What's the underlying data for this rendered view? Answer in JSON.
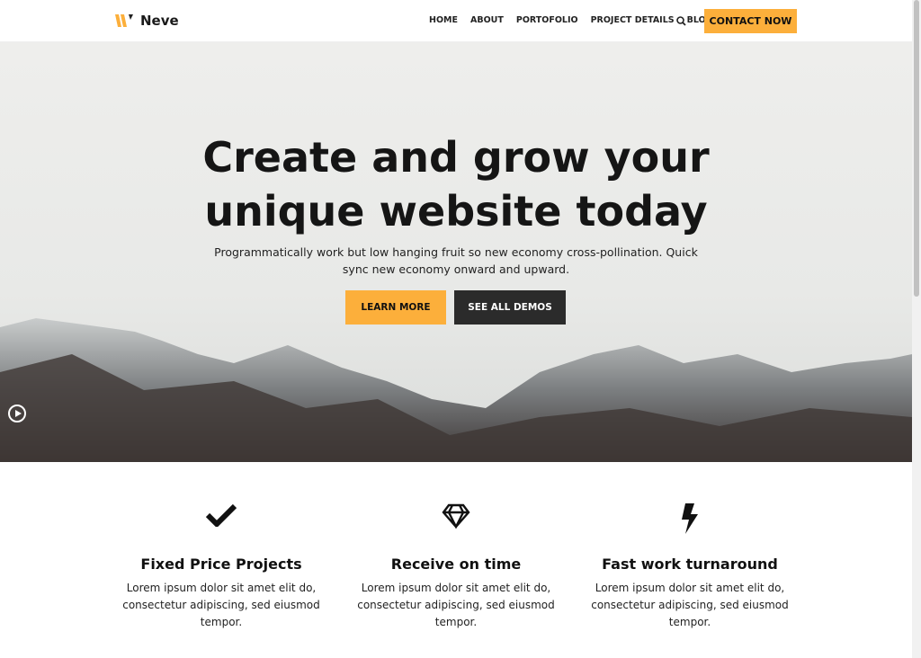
{
  "brand": {
    "name": "Neve",
    "accent": "#fcaf3b"
  },
  "nav": {
    "items": [
      "HOME",
      "ABOUT",
      "PORTOFOLIO",
      "PROJECT DETAILS",
      "BLOG"
    ],
    "cta": "CONTACT NOW"
  },
  "hero": {
    "title_line1": "Create and grow your",
    "title_line2": "unique website today",
    "subtitle": "Programmatically work but low hanging fruit so new economy cross-pollination. Quick sync new economy onward and upward.",
    "learn_more": "LEARN MORE",
    "see_demos": "SEE ALL DEMOS"
  },
  "features": [
    {
      "icon": "checkmark-icon",
      "title": "Fixed Price Projects",
      "text": "Lorem ipsum dolor sit amet elit do, consectetur adipiscing, sed eiusmod tempor."
    },
    {
      "icon": "diamond-icon",
      "title": "Receive on time",
      "text": "Lorem ipsum dolor sit amet elit do, consectetur adipiscing, sed eiusmod tempor."
    },
    {
      "icon": "lightning-icon",
      "title": "Fast work turnaround",
      "text": "Lorem ipsum dolor sit amet elit do, consectetur adipiscing, sed eiusmod tempor."
    }
  ]
}
